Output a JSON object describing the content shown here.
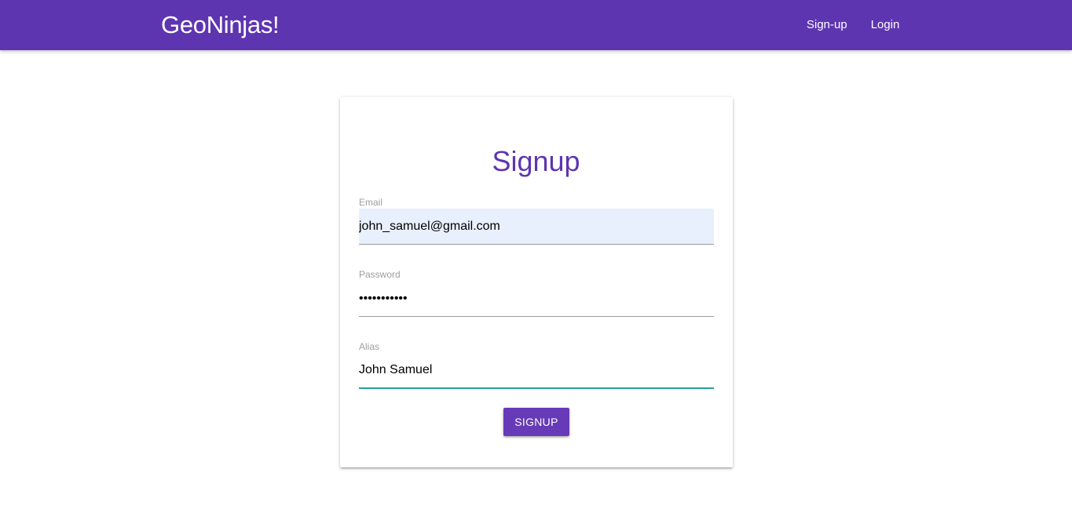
{
  "navbar": {
    "brand": "GeoNinjas!",
    "links": [
      {
        "label": "Sign-up"
      },
      {
        "label": "Login"
      }
    ]
  },
  "signup": {
    "title": "Signup",
    "email": {
      "label": "Email",
      "value": "john_samuel@gmail.com"
    },
    "password": {
      "label": "Password",
      "value": "secretpass1"
    },
    "alias": {
      "label": "Alias",
      "value": "John Samuel"
    },
    "submit_label": "Signup"
  },
  "colors": {
    "brand": "#5e35b1",
    "button": "#673ab7",
    "focus_underline": "#26a69a",
    "autofill_bg": "#e8f0fe"
  }
}
